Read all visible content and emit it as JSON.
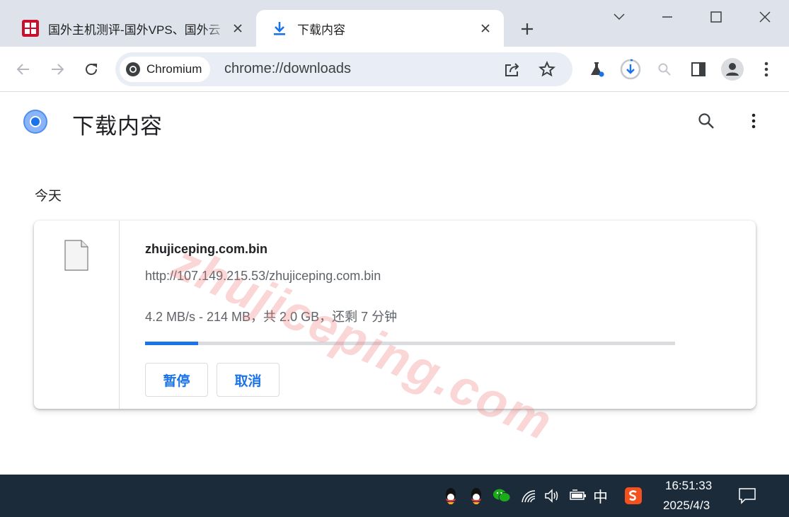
{
  "browser": {
    "tabs": [
      {
        "title": "国外主机测评-国外VPS、国外云",
        "active": false
      },
      {
        "title": "下载内容",
        "active": true
      }
    ],
    "omnibox": {
      "chip_label": "Chromium",
      "url": "chrome://downloads"
    }
  },
  "page": {
    "title": "下载内容",
    "section_label": "今天",
    "download": {
      "file_name": "zhujiceping.com.bin",
      "url": "http://107.149.215.53/zhujiceping.com.bin",
      "status": "4.2 MB/s - 214 MB，共 2.0 GB，还剩 7 分钟",
      "progress_fraction": 0.1,
      "pause_label": "暂停",
      "cancel_label": "取消"
    },
    "watermark": "zhujiceping.com"
  },
  "taskbar": {
    "ime_label": "中",
    "time": "16:51:33",
    "date": "2025/4/3"
  },
  "colors": {
    "accent": "#1a73e8",
    "tabstrip": "#dee3eb",
    "omnibox": "#e9eef6",
    "taskbar": "#1c2b3a"
  }
}
